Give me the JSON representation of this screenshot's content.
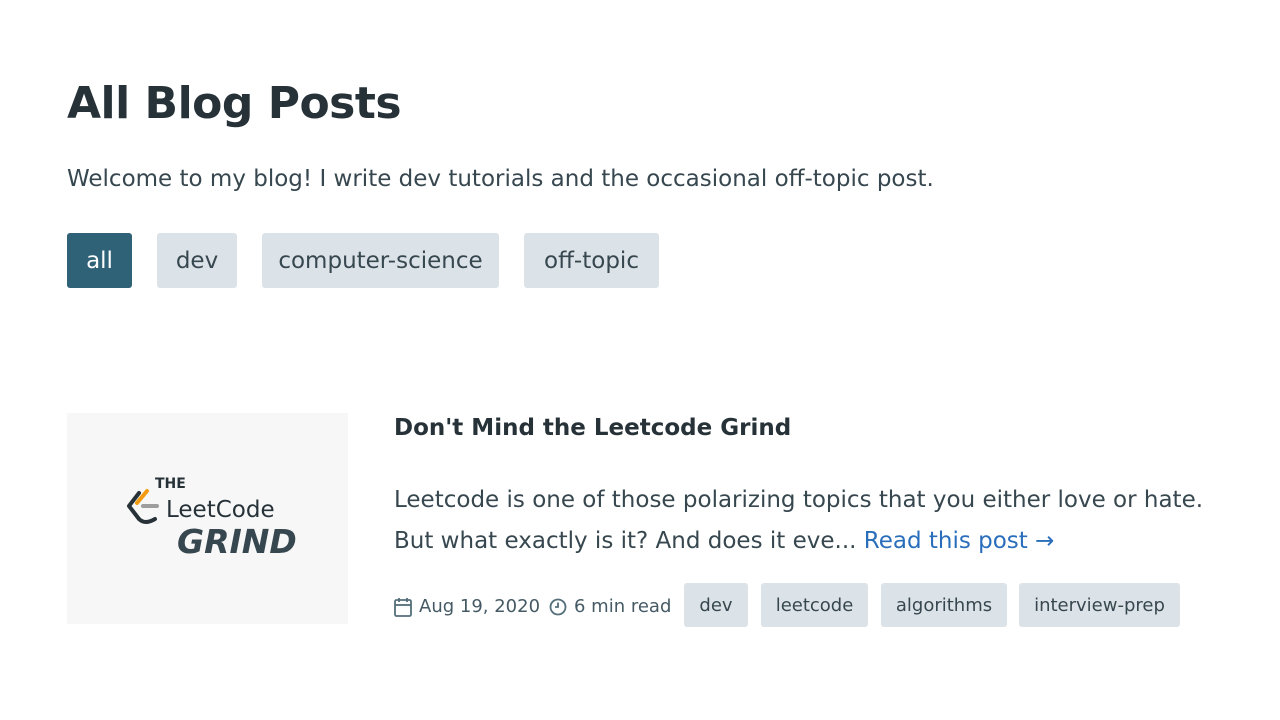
{
  "page": {
    "title": "All Blog Posts",
    "intro": "Welcome to my blog! I write dev tutorials and the occasional off-topic post."
  },
  "filters": [
    {
      "label": "all",
      "active": true
    },
    {
      "label": "dev",
      "active": false
    },
    {
      "label": "computer-science",
      "active": false
    },
    {
      "label": "off-topic",
      "active": false
    }
  ],
  "post": {
    "thumbnail": {
      "line1": "THE",
      "line2": "LeetCode",
      "line3": "GRIND"
    },
    "title": "Don't Mind the Leetcode Grind",
    "excerpt": "Leetcode is one of those polarizing topics that you either love or hate. But what exactly is it? And does it eve...",
    "read_more": "Read this post →",
    "date": "Aug 19, 2020",
    "date_icon": "calendar-icon",
    "read_time": "6 min read",
    "read_time_icon": "clock-icon",
    "tags": [
      "dev",
      "leetcode",
      "algorithms",
      "interview-prep"
    ]
  },
  "colors": {
    "accent": "#2f6177",
    "chip": "#dce3e8",
    "link": "#2a6ebb",
    "text": "#263238"
  }
}
